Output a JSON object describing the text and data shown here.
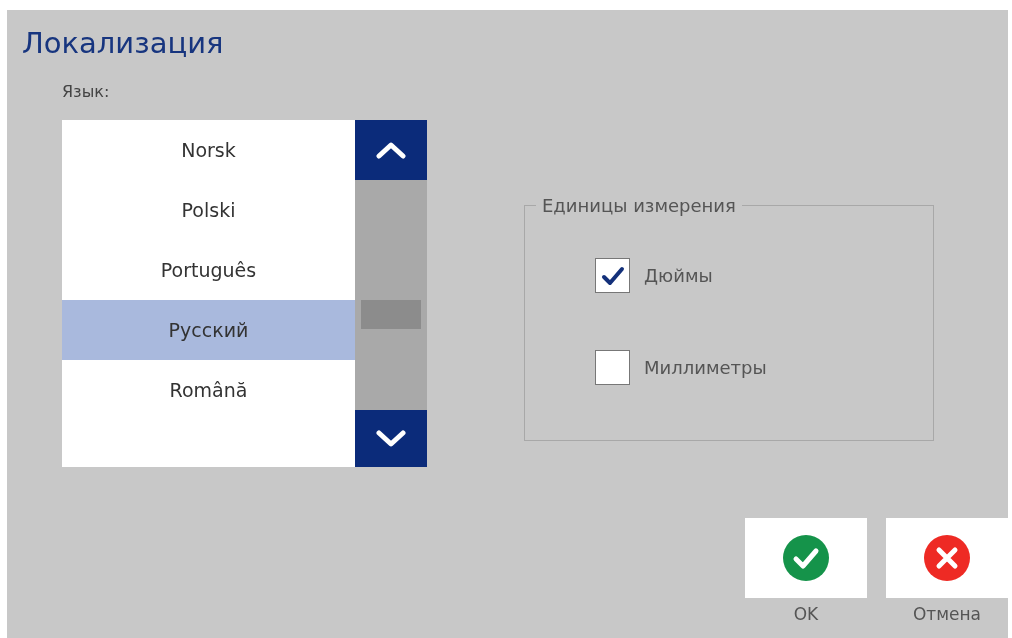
{
  "window": {
    "title": "Локализация"
  },
  "language": {
    "label": "Язык:",
    "items": [
      {
        "label": "Norsk",
        "selected": false
      },
      {
        "label": "Polski",
        "selected": false
      },
      {
        "label": "Português",
        "selected": false
      },
      {
        "label": "Русский",
        "selected": true
      },
      {
        "label": "Română",
        "selected": false
      }
    ]
  },
  "units": {
    "legend": "Единицы измерения",
    "options": [
      {
        "label": "Дюймы",
        "checked": true
      },
      {
        "label": "Миллиметры",
        "checked": false
      }
    ]
  },
  "buttons": [
    {
      "kind": "ok",
      "label": "OK"
    },
    {
      "kind": "cancel",
      "label": "Отмена"
    }
  ]
}
